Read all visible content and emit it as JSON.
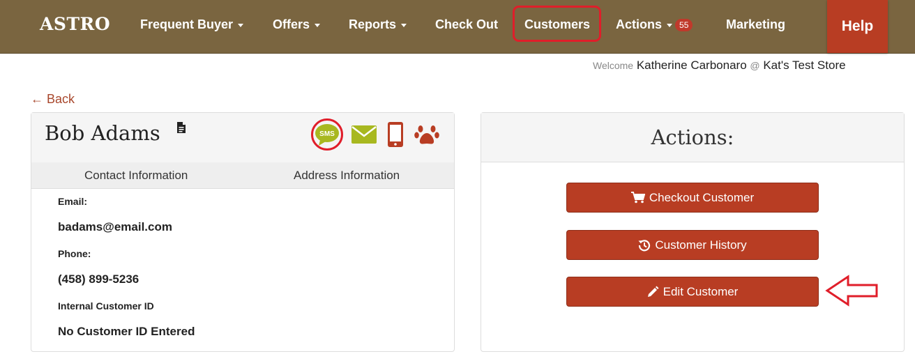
{
  "nav": {
    "logo": "ASTRO",
    "items": [
      {
        "label": "Frequent Buyer"
      },
      {
        "label": "Offers"
      },
      {
        "label": "Reports"
      },
      {
        "label": "Check Out"
      },
      {
        "label": "Customers"
      },
      {
        "label": "Actions",
        "badge": "55"
      },
      {
        "label": "Marketing"
      }
    ],
    "help": "Help"
  },
  "welcome": {
    "prefix": "Welcome",
    "user": "Katherine Carbonaro",
    "at": "@",
    "store": "Kat's Test Store"
  },
  "back_label": "Back",
  "customer": {
    "name": "Bob Adams",
    "tabs": [
      "Contact Information",
      "Address Information"
    ],
    "email_label": "Email:",
    "email": "badams@email.com",
    "phone_label": "Phone:",
    "phone": "(458) 899-5236",
    "id_label": "Internal Customer ID",
    "id_value": "No Customer ID Entered",
    "icons": [
      "sms-icon",
      "email-icon",
      "mobile-icon",
      "paw-icon"
    ],
    "sms_text": "SMS"
  },
  "actions": {
    "title": "Actions:",
    "buttons": [
      {
        "label": "Checkout Customer",
        "icon": "cart-icon"
      },
      {
        "label": "Customer History",
        "icon": "history-icon"
      },
      {
        "label": "Edit Customer",
        "icon": "pencil-icon"
      }
    ]
  },
  "colors": {
    "navbar": "#7a6540",
    "accent": "#b83d23",
    "link": "#a8472c",
    "sms": "#a8b820",
    "annotation": "#e01e2a"
  }
}
